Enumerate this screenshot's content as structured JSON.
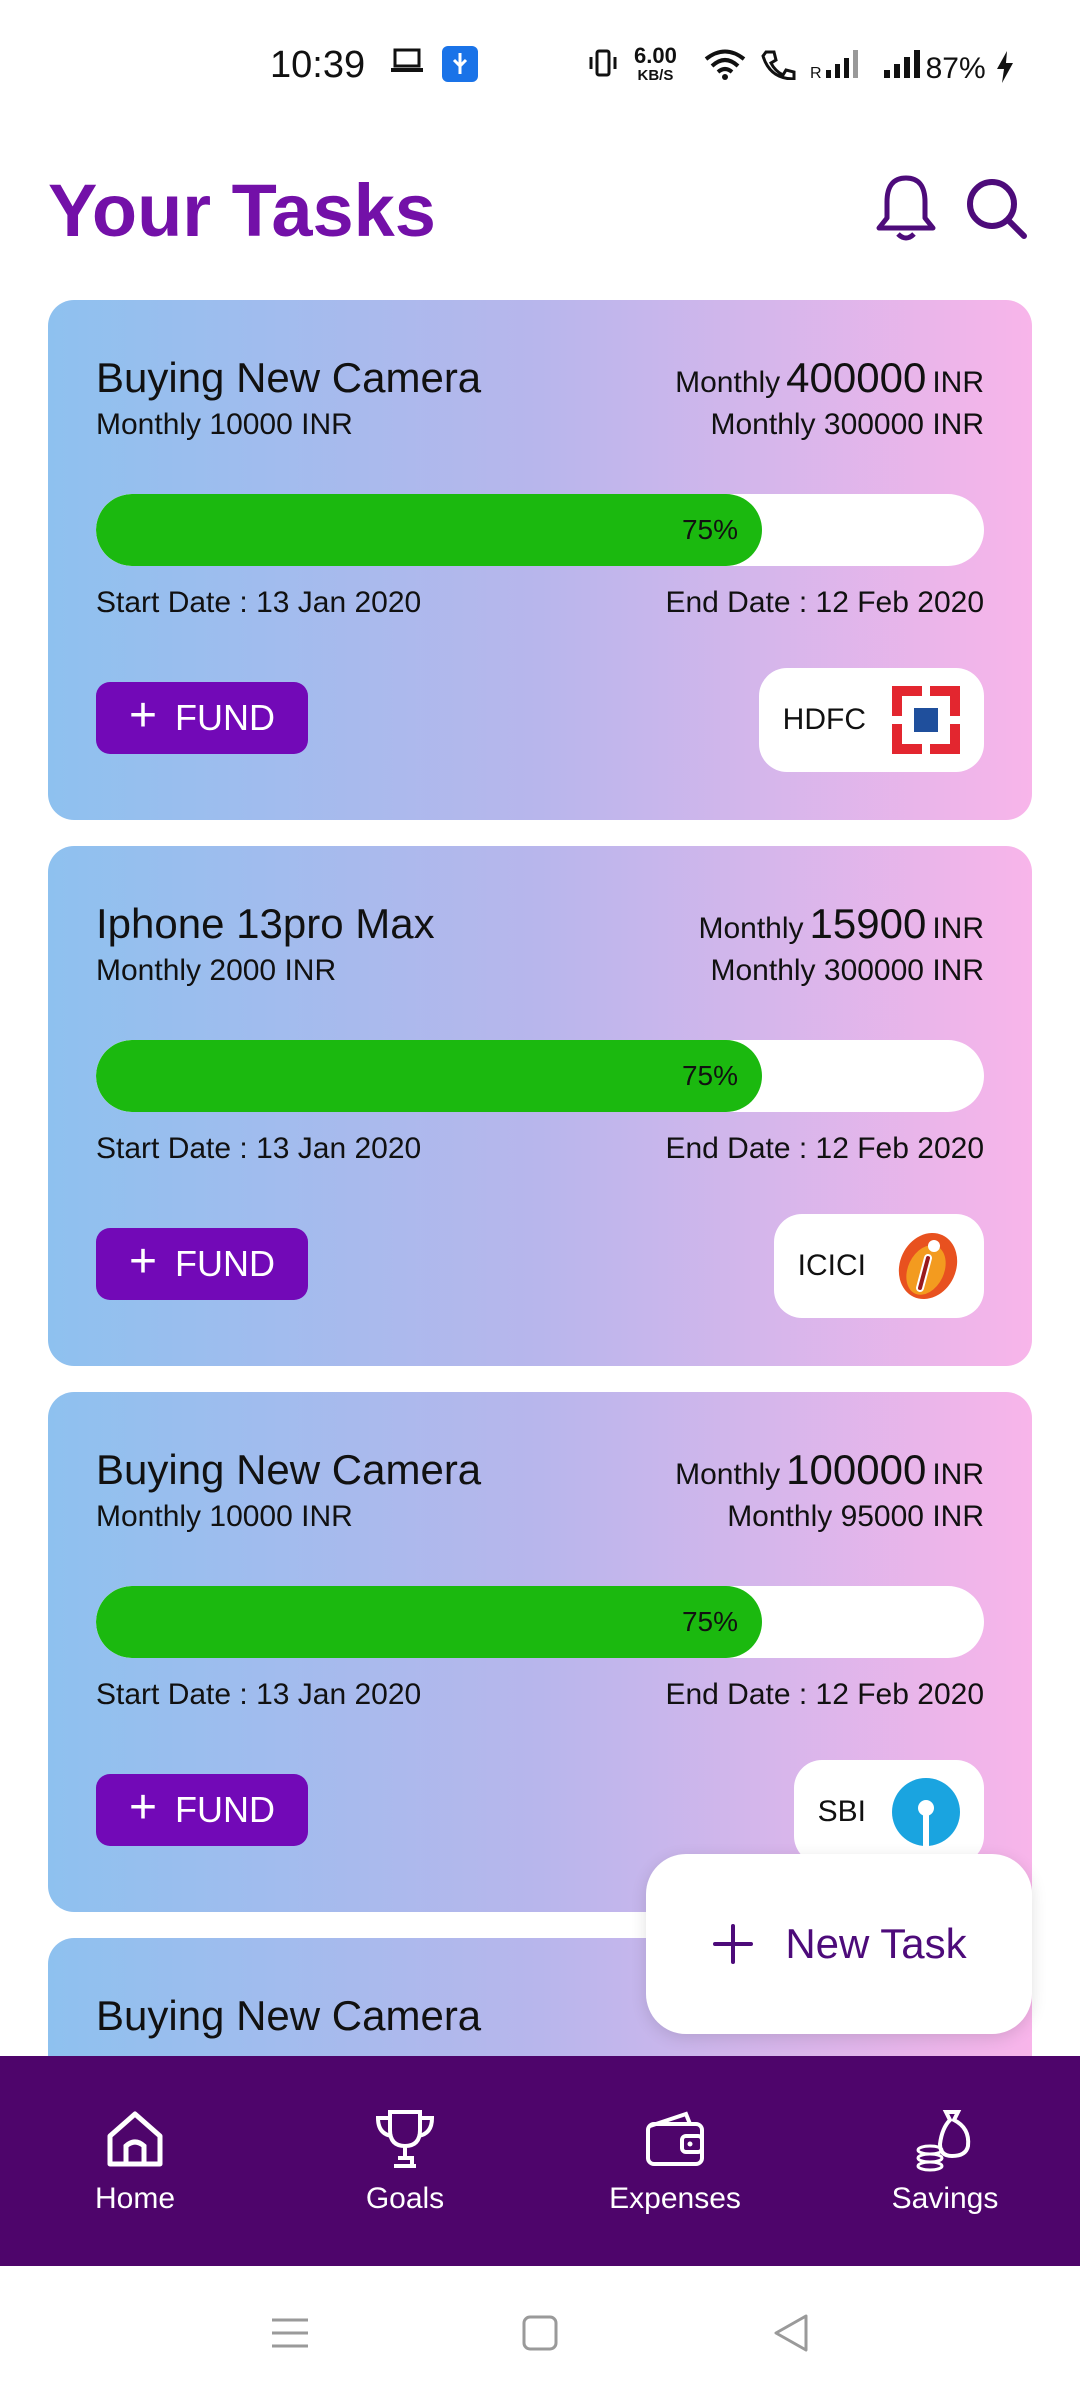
{
  "status_bar": {
    "time": "10:39",
    "speed_value": "6.00",
    "speed_unit": "KB/S",
    "battery": "87%"
  },
  "header": {
    "title": "Your Tasks",
    "notification_icon": "bell-icon",
    "search_icon": "search-icon"
  },
  "tasks": [
    {
      "name": "Buying New Camera",
      "monthly_sub": "Monthly  10000  INR",
      "target_prefix": "Monthly",
      "target_amount": "400000",
      "target_unit": "INR",
      "saved_line": "Monthly  300000  INR",
      "progress": 0.75,
      "progress_label": "75%",
      "start_date": "Start Date :  13 Jan 2020",
      "end_date": "End Date :  12 Feb 2020",
      "fund_label": "FUND",
      "bank": "HDFC",
      "bank_logo": "hdfc-logo"
    },
    {
      "name": "Iphone 13pro Max",
      "monthly_sub": "Monthly  2000  INR",
      "target_prefix": "Monthly",
      "target_amount": "15900",
      "target_unit": "INR",
      "saved_line": "Monthly  300000  INR",
      "progress": 0.75,
      "progress_label": "75%",
      "start_date": "Start Date :  13 Jan 2020",
      "end_date": "End Date :  12 Feb 2020",
      "fund_label": "FUND",
      "bank": "ICICI",
      "bank_logo": "icici-logo"
    },
    {
      "name": "Buying New Camera",
      "monthly_sub": "Monthly  10000  INR",
      "target_prefix": "Monthly",
      "target_amount": "100000",
      "target_unit": "INR",
      "saved_line": "Monthly  95000  INR",
      "progress": 0.75,
      "progress_label": "75%",
      "start_date": "Start Date :  13 Jan 2020",
      "end_date": "End Date :  12 Feb 2020",
      "fund_label": "FUND",
      "bank": "SBI",
      "bank_logo": "sbi-logo"
    },
    {
      "name": "Buying New Camera"
    }
  ],
  "new_task": {
    "label": "New Task"
  },
  "bottom_nav": [
    {
      "label": "Home",
      "icon": "home-icon"
    },
    {
      "label": "Goals",
      "icon": "trophy-icon"
    },
    {
      "label": "Expenses",
      "icon": "wallet-icon"
    },
    {
      "label": "Savings",
      "icon": "savings-icon"
    }
  ],
  "colors": {
    "title": "#7310a8",
    "fund_button": "#7209b7",
    "progress_fill": "#1bb90f",
    "bottom_nav": "#4e056b"
  }
}
